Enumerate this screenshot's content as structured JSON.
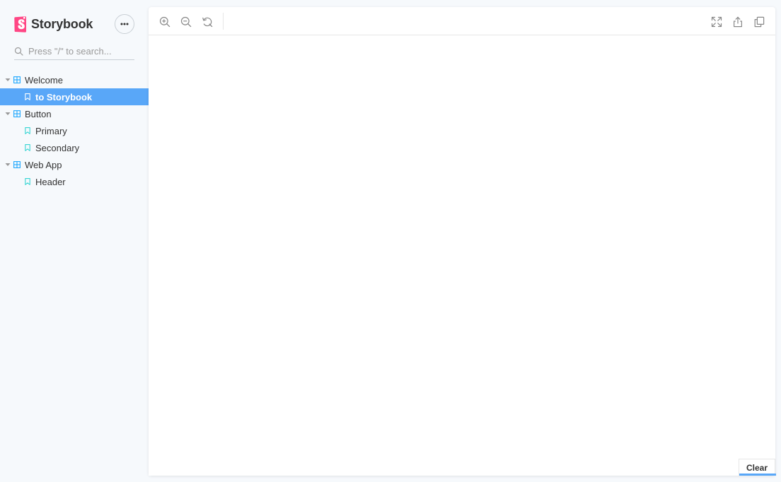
{
  "app": {
    "title": "Storybook"
  },
  "sidebar": {
    "menu_icon": "ellipsis-icon",
    "search": {
      "placeholder": "Press \"/\" to search..."
    },
    "tree": [
      {
        "type": "component",
        "label": "Welcome",
        "expanded": true
      },
      {
        "type": "story",
        "label": "to Storybook",
        "selected": true
      },
      {
        "type": "component",
        "label": "Button",
        "expanded": true
      },
      {
        "type": "story",
        "label": "Primary"
      },
      {
        "type": "story",
        "label": "Secondary"
      },
      {
        "type": "component",
        "label": "Web App",
        "expanded": true
      },
      {
        "type": "story",
        "label": "Header"
      }
    ]
  },
  "toolbar": {
    "left_tools": [
      "zoom-in-icon",
      "zoom-out-icon",
      "zoom-reset-icon"
    ],
    "right_tools": [
      "fullscreen-icon",
      "share-icon",
      "copy-icon"
    ]
  },
  "actions": {
    "clear_label": "Clear"
  },
  "colors": {
    "accent": "#59A7F8",
    "brand": "#FF4785",
    "sidebar_bg": "#F6F9FC",
    "story_icon": "#37D5D3",
    "component_icon": "#1EA7FD"
  }
}
